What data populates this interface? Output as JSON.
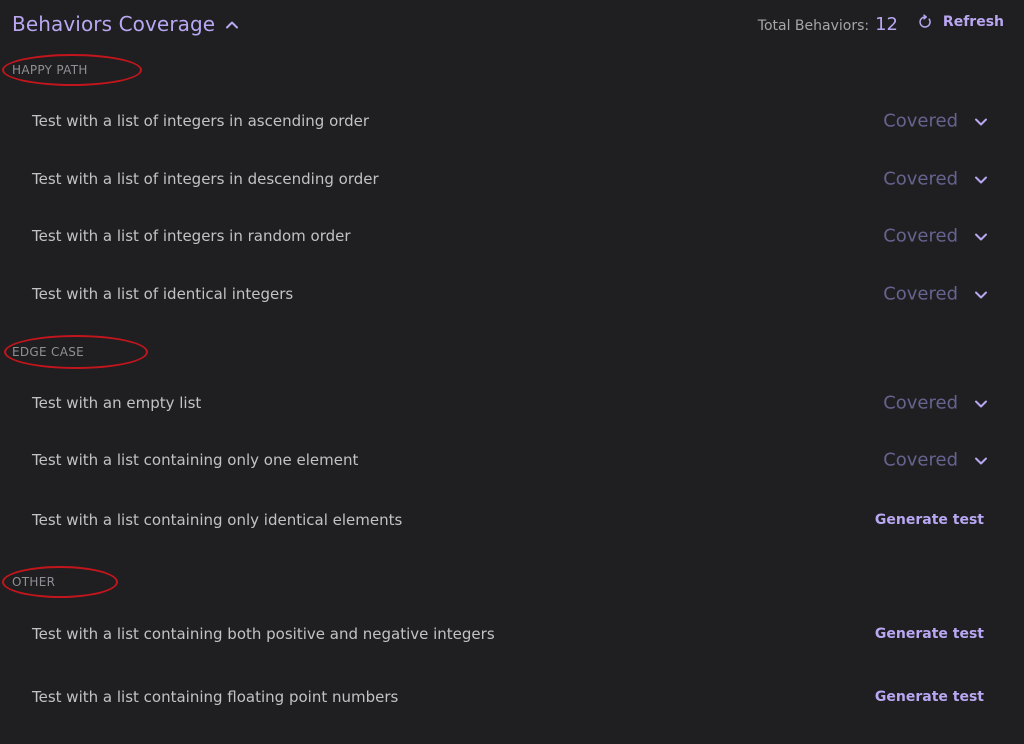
{
  "header": {
    "title": "Behaviors Coverage",
    "total_label": "Total Behaviors:",
    "total_count": "12",
    "refresh_label": "Refresh"
  },
  "sections": [
    {
      "label": "HAPPY PATH",
      "items": [
        {
          "text": "Test with a list of integers in ascending order",
          "status": "Covered"
        },
        {
          "text": "Test with a list of integers in descending order",
          "status": "Covered"
        },
        {
          "text": "Test with a list of integers in random order",
          "status": "Covered"
        },
        {
          "text": "Test with a list of identical integers",
          "status": "Covered"
        }
      ]
    },
    {
      "label": "EDGE CASE",
      "items": [
        {
          "text": "Test with an empty list",
          "status": "Covered"
        },
        {
          "text": "Test with a list containing only one element",
          "status": "Covered"
        },
        {
          "text": "Test with a list containing only identical elements",
          "action": "Generate test"
        }
      ]
    },
    {
      "label": "OTHER",
      "items": [
        {
          "text": "Test with a list containing both positive and negative integers",
          "action": "Generate test"
        },
        {
          "text": "Test with a list containing floating point numbers",
          "action": "Generate test"
        }
      ]
    }
  ],
  "colors": {
    "background": "#1f1f21",
    "accent": "#b9a7f2",
    "covered": "#67628f",
    "annotation": "#c3151c"
  },
  "icons": {
    "collapse": "chevron-up-icon",
    "refresh": "refresh-icon",
    "expand": "chevron-down-icon"
  }
}
